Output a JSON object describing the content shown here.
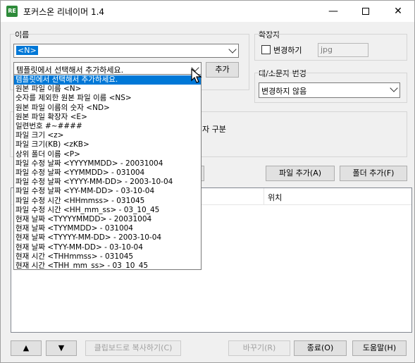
{
  "window": {
    "title": "포커스온 리네이머 1.4",
    "app_icon": "RE"
  },
  "name_group": {
    "label": "이름",
    "name_value": "<N>",
    "template_combo": "템플릿에서 선택해서 추가하세요.",
    "add_button": "추가"
  },
  "extension_group": {
    "label": "확장자",
    "change_checkbox": "변경하기",
    "extension_value": "jpg"
  },
  "case_group": {
    "label": "대/소문자 변경",
    "selected": "변경하지 않음"
  },
  "partial_label": "자 구분",
  "buttons": {
    "add_file": "파일 추가(A)",
    "add_folder": "폴더 추가(F)",
    "up": "▲",
    "down": "▼",
    "copy_clipboard": "클립보드로 복사하기(C)",
    "change": "바꾸기(R)",
    "exit": "종료(O)",
    "help": "도움말(H)"
  },
  "list": {
    "col_location": "위치"
  },
  "dropdown_items": [
    "템플릿에서 선택해서 추가하세요.",
    "원본 파일 이름 <N>",
    "숫자를 제외한 원본 파일 이름 <NS>",
    "원본 파일 이름의 숫자 <ND>",
    "원본 파일 확장자 <E>",
    "일련번호 #~####",
    "파일 크기 <z>",
    "파일 크기(KB) <zKB>",
    "상위 폴더 이름 <P>",
    "파일 수정 날짜 <YYYYMMDD> - 20031004",
    "파일 수정 날짜 <YYMMDD> - 031004",
    "파일 수정 날짜 <YYYY-MM-DD> - 2003-10-04",
    "파일 수정 날짜 <YY-MM-DD> - 03-10-04",
    "파일 수정 시간 <HHmmss> - 031045",
    "파일 수정 시간 <HH_mm_ss> - 03_10_45",
    "현재 날짜 <TYYYYMMDD> - 20031004",
    "현재 날짜 <TYYMMDD> - 031004",
    "현재 날짜 <TYYYY-MM-DD> - 2003-10-04",
    "현재 날짜 <TYY-MM-DD> - 03-10-04",
    "현재 시간 <THHmmss> - 031045",
    "현재 시간 <THH_mm_ss> - 03_10_45"
  ]
}
